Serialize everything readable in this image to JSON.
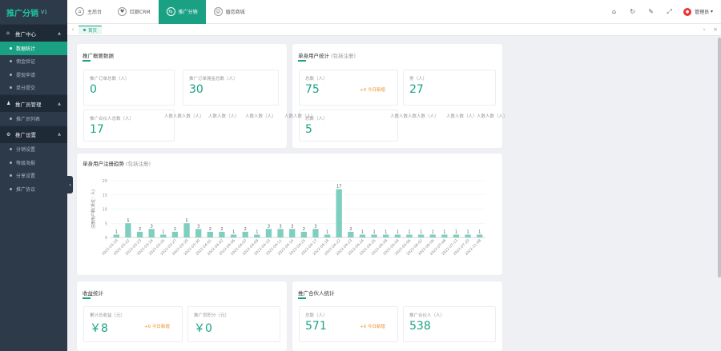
{
  "brand": {
    "name": "推广分销",
    "version": "V1"
  },
  "sidebar": {
    "groups": [
      {
        "label": "推广中心",
        "icon": "home-icon",
        "items": [
          {
            "label": "数据统计",
            "active": true
          },
          {
            "label": "佣金验证"
          },
          {
            "label": "提现申请"
          },
          {
            "label": "单分提交"
          }
        ]
      },
      {
        "label": "推广员管理",
        "icon": "user-icon",
        "items": [
          {
            "label": "推广员列表"
          }
        ]
      },
      {
        "label": "推广设置",
        "icon": "gear-icon",
        "items": [
          {
            "label": "分销设置"
          },
          {
            "label": "等级海报"
          },
          {
            "label": "分享设置"
          },
          {
            "label": "推广协议"
          }
        ]
      }
    ],
    "collapse": "‹"
  },
  "topbar": {
    "tabs": [
      {
        "label": "主后台",
        "icon": "home-icon"
      },
      {
        "label": "红娘CRM",
        "icon": "crm-icon"
      },
      {
        "label": "推广分销",
        "icon": "share-icon",
        "active": true
      },
      {
        "label": "婚恋商城",
        "icon": "shop-icon"
      }
    ],
    "icons": [
      "home-icon",
      "refresh-icon",
      "theme-icon",
      "fullscreen-icon"
    ],
    "user": "管理员"
  },
  "tabs_bar": {
    "prev": "‹",
    "next": "›",
    "tab": "首页",
    "right": [
      "›",
      "×"
    ]
  },
  "overview": {
    "title": "推广概要数据",
    "stats": [
      {
        "label": "推广订单总数（人）",
        "value": "0"
      },
      {
        "label": "推广订单佣金总数（人）",
        "value": "30"
      },
      {
        "label": "推广合伙人总数（人）",
        "value": "17"
      }
    ],
    "ghost_labels": [
      "人数人数人数（人）",
      "人数人数（人）",
      "人数人数（人）",
      "人数人数（人）",
      "人数人数人数人数（人）",
      "人数人数（人）",
      "人数人数（人）"
    ]
  },
  "single_user": {
    "title": "单身用户统计",
    "subtitle": "(包括注册)",
    "total": {
      "label": "总数（人）",
      "value": "75",
      "note": "+0 今日新增"
    },
    "second": {
      "label": "男（人）",
      "value": "27"
    },
    "ghost": {
      "label": "总数（人）",
      "value": "5"
    }
  },
  "chart_section": {
    "title": "单身用户注册趋势",
    "subtitle": "(包括注册)",
    "ylabel": "注册用户数(单位：人)"
  },
  "revenue": {
    "title": "收益统计",
    "accum": {
      "label": "累计总收益（元）",
      "value": "￥8",
      "note": "+0 今日新增"
    },
    "reward": {
      "label": "推广员积分（元）",
      "value": "￥0"
    }
  },
  "partner": {
    "title": "推广合伙人统计",
    "total": {
      "label": "总数（人）",
      "value": "571",
      "note": "+0 今日新增"
    },
    "partners": {
      "label": "推广合伙人（人）",
      "value": "538"
    }
  },
  "chart_data": {
    "type": "bar",
    "ylabel": "注册用户数(单位：人)",
    "ylim": [
      0,
      20
    ],
    "yticks": [
      0,
      5,
      10,
      15,
      20
    ],
    "color": "#7ecfbf",
    "title": "单身用户注册趋势",
    "subtitle": "(包括注册)",
    "categories": [
      "2022-03-19",
      "2022-03-22",
      "2022-03-23",
      "2022-03-24",
      "2022-03-25",
      "2022-03-27",
      "2022-03-29",
      "2022-03-30",
      "2022-04-01",
      "2022-04-02",
      "2022-04-06",
      "2022-04-07",
      "2022-04-09",
      "2022-04-10",
      "2022-04-11",
      "2022-04-14",
      "2022-04-15",
      "2022-04-17",
      "2022-04-18",
      "2022-04-22",
      "2022-04-23",
      "2022-04-24",
      "2022-04-26",
      "2022-04-28",
      "2022-05-04",
      "2022-05-06",
      "2022-06-02",
      "2022-06-06",
      "2022-07-08",
      "2022-07-13",
      "2022-07-20",
      "2022-11-08"
    ],
    "values": [
      1,
      5,
      2,
      3,
      1,
      2,
      5,
      3,
      2,
      2,
      1,
      2,
      1,
      3,
      3,
      3,
      2,
      3,
      1,
      17,
      2,
      1,
      1,
      1,
      1,
      1,
      1,
      1,
      1,
      1,
      1,
      1
    ]
  }
}
